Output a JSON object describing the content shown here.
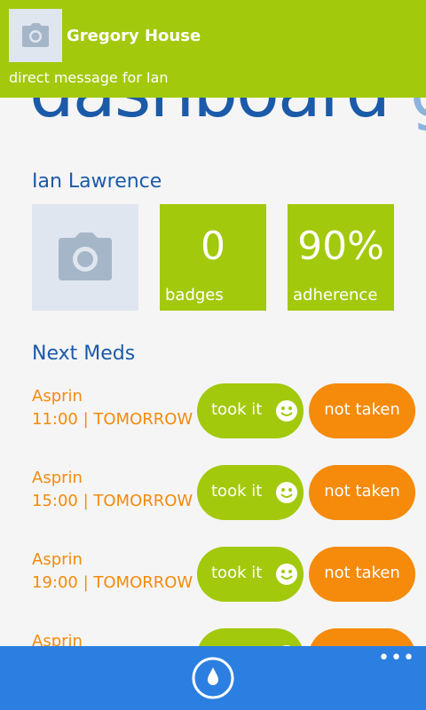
{
  "notification": {
    "sender": "Gregory House",
    "message": "direct message for Ian",
    "avatar_icon": "camera-icon"
  },
  "dashboard": {
    "title_visible": "dashboard",
    "title_next": "gro",
    "user_name": "Ian Lawrence",
    "avatar_icon": "camera-icon",
    "stats": {
      "badges": {
        "value": "0",
        "label": "badges"
      },
      "adherence": {
        "value": "90%",
        "label": "adherence"
      }
    },
    "next_meds_heading": "Next Meds",
    "meds": [
      {
        "name": "Asprin",
        "time": "11:00 | TOMORROW",
        "took_label": "took it",
        "not_label": "not taken"
      },
      {
        "name": "Asprin",
        "time": "15:00 | TOMORROW",
        "took_label": "took it",
        "not_label": "not taken"
      },
      {
        "name": "Asprin",
        "time": "19:00 | TOMORROW",
        "took_label": "took it",
        "not_label": "not taken"
      },
      {
        "name": "Asprin",
        "time": "",
        "took_label": "",
        "not_label": ""
      }
    ]
  },
  "appbar": {
    "main_icon": "water-drop-icon",
    "more_label": "•••"
  },
  "colors": {
    "accent_green": "#a2c90c",
    "accent_orange": "#f58a0b",
    "heading_blue": "#1b5aa8",
    "appbar_blue": "#2b7fe0"
  }
}
